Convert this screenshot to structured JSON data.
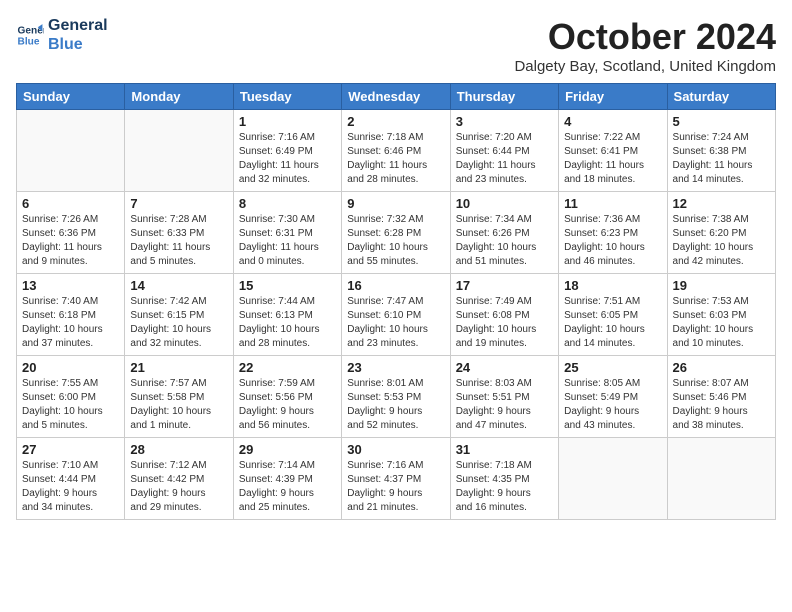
{
  "header": {
    "logo_line1": "General",
    "logo_line2": "Blue",
    "month": "October 2024",
    "location": "Dalgety Bay, Scotland, United Kingdom"
  },
  "days_of_week": [
    "Sunday",
    "Monday",
    "Tuesday",
    "Wednesday",
    "Thursday",
    "Friday",
    "Saturday"
  ],
  "weeks": [
    [
      {
        "day": "",
        "info": ""
      },
      {
        "day": "",
        "info": ""
      },
      {
        "day": "1",
        "info": "Sunrise: 7:16 AM\nSunset: 6:49 PM\nDaylight: 11 hours\nand 32 minutes."
      },
      {
        "day": "2",
        "info": "Sunrise: 7:18 AM\nSunset: 6:46 PM\nDaylight: 11 hours\nand 28 minutes."
      },
      {
        "day": "3",
        "info": "Sunrise: 7:20 AM\nSunset: 6:44 PM\nDaylight: 11 hours\nand 23 minutes."
      },
      {
        "day": "4",
        "info": "Sunrise: 7:22 AM\nSunset: 6:41 PM\nDaylight: 11 hours\nand 18 minutes."
      },
      {
        "day": "5",
        "info": "Sunrise: 7:24 AM\nSunset: 6:38 PM\nDaylight: 11 hours\nand 14 minutes."
      }
    ],
    [
      {
        "day": "6",
        "info": "Sunrise: 7:26 AM\nSunset: 6:36 PM\nDaylight: 11 hours\nand 9 minutes."
      },
      {
        "day": "7",
        "info": "Sunrise: 7:28 AM\nSunset: 6:33 PM\nDaylight: 11 hours\nand 5 minutes."
      },
      {
        "day": "8",
        "info": "Sunrise: 7:30 AM\nSunset: 6:31 PM\nDaylight: 11 hours\nand 0 minutes."
      },
      {
        "day": "9",
        "info": "Sunrise: 7:32 AM\nSunset: 6:28 PM\nDaylight: 10 hours\nand 55 minutes."
      },
      {
        "day": "10",
        "info": "Sunrise: 7:34 AM\nSunset: 6:26 PM\nDaylight: 10 hours\nand 51 minutes."
      },
      {
        "day": "11",
        "info": "Sunrise: 7:36 AM\nSunset: 6:23 PM\nDaylight: 10 hours\nand 46 minutes."
      },
      {
        "day": "12",
        "info": "Sunrise: 7:38 AM\nSunset: 6:20 PM\nDaylight: 10 hours\nand 42 minutes."
      }
    ],
    [
      {
        "day": "13",
        "info": "Sunrise: 7:40 AM\nSunset: 6:18 PM\nDaylight: 10 hours\nand 37 minutes."
      },
      {
        "day": "14",
        "info": "Sunrise: 7:42 AM\nSunset: 6:15 PM\nDaylight: 10 hours\nand 32 minutes."
      },
      {
        "day": "15",
        "info": "Sunrise: 7:44 AM\nSunset: 6:13 PM\nDaylight: 10 hours\nand 28 minutes."
      },
      {
        "day": "16",
        "info": "Sunrise: 7:47 AM\nSunset: 6:10 PM\nDaylight: 10 hours\nand 23 minutes."
      },
      {
        "day": "17",
        "info": "Sunrise: 7:49 AM\nSunset: 6:08 PM\nDaylight: 10 hours\nand 19 minutes."
      },
      {
        "day": "18",
        "info": "Sunrise: 7:51 AM\nSunset: 6:05 PM\nDaylight: 10 hours\nand 14 minutes."
      },
      {
        "day": "19",
        "info": "Sunrise: 7:53 AM\nSunset: 6:03 PM\nDaylight: 10 hours\nand 10 minutes."
      }
    ],
    [
      {
        "day": "20",
        "info": "Sunrise: 7:55 AM\nSunset: 6:00 PM\nDaylight: 10 hours\nand 5 minutes."
      },
      {
        "day": "21",
        "info": "Sunrise: 7:57 AM\nSunset: 5:58 PM\nDaylight: 10 hours\nand 1 minute."
      },
      {
        "day": "22",
        "info": "Sunrise: 7:59 AM\nSunset: 5:56 PM\nDaylight: 9 hours\nand 56 minutes."
      },
      {
        "day": "23",
        "info": "Sunrise: 8:01 AM\nSunset: 5:53 PM\nDaylight: 9 hours\nand 52 minutes."
      },
      {
        "day": "24",
        "info": "Sunrise: 8:03 AM\nSunset: 5:51 PM\nDaylight: 9 hours\nand 47 minutes."
      },
      {
        "day": "25",
        "info": "Sunrise: 8:05 AM\nSunset: 5:49 PM\nDaylight: 9 hours\nand 43 minutes."
      },
      {
        "day": "26",
        "info": "Sunrise: 8:07 AM\nSunset: 5:46 PM\nDaylight: 9 hours\nand 38 minutes."
      }
    ],
    [
      {
        "day": "27",
        "info": "Sunrise: 7:10 AM\nSunset: 4:44 PM\nDaylight: 9 hours\nand 34 minutes."
      },
      {
        "day": "28",
        "info": "Sunrise: 7:12 AM\nSunset: 4:42 PM\nDaylight: 9 hours\nand 29 minutes."
      },
      {
        "day": "29",
        "info": "Sunrise: 7:14 AM\nSunset: 4:39 PM\nDaylight: 9 hours\nand 25 minutes."
      },
      {
        "day": "30",
        "info": "Sunrise: 7:16 AM\nSunset: 4:37 PM\nDaylight: 9 hours\nand 21 minutes."
      },
      {
        "day": "31",
        "info": "Sunrise: 7:18 AM\nSunset: 4:35 PM\nDaylight: 9 hours\nand 16 minutes."
      },
      {
        "day": "",
        "info": ""
      },
      {
        "day": "",
        "info": ""
      }
    ]
  ]
}
